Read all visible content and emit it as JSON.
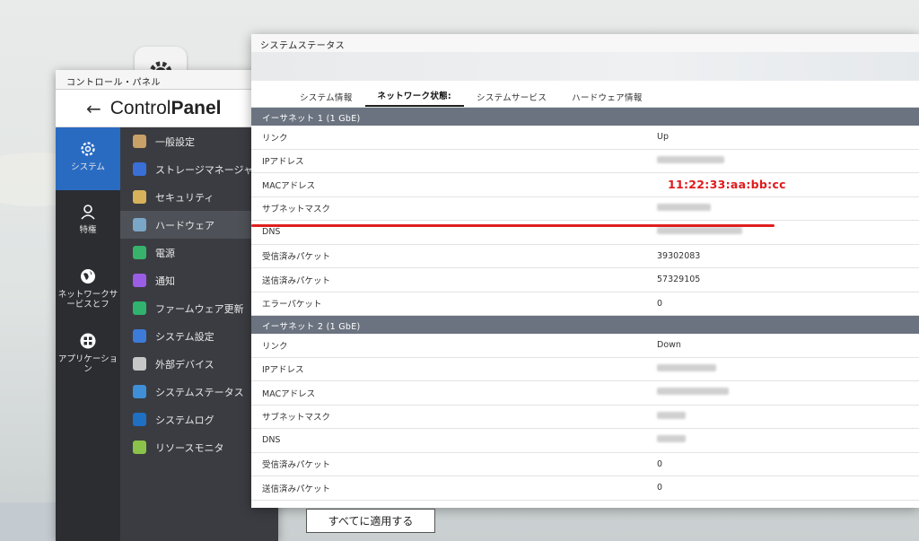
{
  "control_panel": {
    "window_title": "コントロール・パネル",
    "brand_light": "Control",
    "brand_bold": "Panel",
    "categories": [
      {
        "label": "システム",
        "icon": "gear-icon",
        "active": true
      },
      {
        "label": "特権",
        "icon": "user-icon",
        "active": false
      },
      {
        "label": "ネットワークサービスとフ",
        "icon": "globe-icon",
        "active": false
      },
      {
        "label": "アプリケーション",
        "icon": "apps-icon",
        "active": false
      }
    ],
    "items": [
      {
        "label": "一般設定",
        "icon": "clipboard-icon",
        "color": "#c9a067"
      },
      {
        "label": "ストレージマネージャ",
        "icon": "database-icon",
        "color": "#3a6fd8"
      },
      {
        "label": "セキュリティ",
        "icon": "lock-icon",
        "color": "#d8b25a"
      },
      {
        "label": "ハードウェア",
        "icon": "hardware-icon",
        "color": "#7aa7c7"
      },
      {
        "label": "電源",
        "icon": "power-icon",
        "color": "#37b36b"
      },
      {
        "label": "通知",
        "icon": "notification-icon",
        "color": "#9b5de5"
      },
      {
        "label": "ファームウェア更新",
        "icon": "firmware-update-icon",
        "color": "#2fb36e"
      },
      {
        "label": "システム設定",
        "icon": "system-settings-icon",
        "color": "#3c7bd8"
      },
      {
        "label": "外部デバイス",
        "icon": "external-device-icon",
        "color": "#c7c7c7"
      },
      {
        "label": "システムステータス",
        "icon": "monitor-icon",
        "color": "#3f8fd8"
      },
      {
        "label": "システムログ",
        "icon": "log-icon",
        "color": "#1f6fc2"
      },
      {
        "label": "リソースモニタ",
        "icon": "resource-monitor-icon",
        "color": "#8bc34a"
      }
    ],
    "active_item_index": 3
  },
  "status_window": {
    "title": "システムステータス",
    "tabs": [
      {
        "label": "システム情報",
        "active": false
      },
      {
        "label": "ネットワーク状態:",
        "active": true
      },
      {
        "label": "システムサービス",
        "active": false
      },
      {
        "label": "ハードウェア情報",
        "active": false
      }
    ],
    "sections": [
      {
        "header": "イーサネット 1 (1 GbE)",
        "rows": [
          {
            "key": "リンク",
            "value": "Up"
          },
          {
            "key": "IPアドレス",
            "value": ""
          },
          {
            "key": "MACアドレス",
            "value": "11:22:33:aa:bb:cc"
          },
          {
            "key": "サブネットマスク",
            "value": ""
          },
          {
            "key": "DNS",
            "value": ""
          },
          {
            "key": "受信済みパケット",
            "value": "39302083"
          },
          {
            "key": "送信済みパケット",
            "value": "57329105"
          },
          {
            "key": "エラーパケット",
            "value": "0"
          }
        ]
      },
      {
        "header": "イーサネット 2 (1 GbE)",
        "rows": [
          {
            "key": "リンク",
            "value": "Down"
          },
          {
            "key": "IPアドレス",
            "value": ""
          },
          {
            "key": "MACアドレス",
            "value": ""
          },
          {
            "key": "サブネットマスク",
            "value": ""
          },
          {
            "key": "DNS",
            "value": ""
          },
          {
            "key": "受信済みパケット",
            "value": "0"
          },
          {
            "key": "送信済みパケット",
            "value": "0"
          }
        ]
      }
    ],
    "apply_all_label": "すべてに適用する",
    "highlight_color": "#e0191c"
  }
}
